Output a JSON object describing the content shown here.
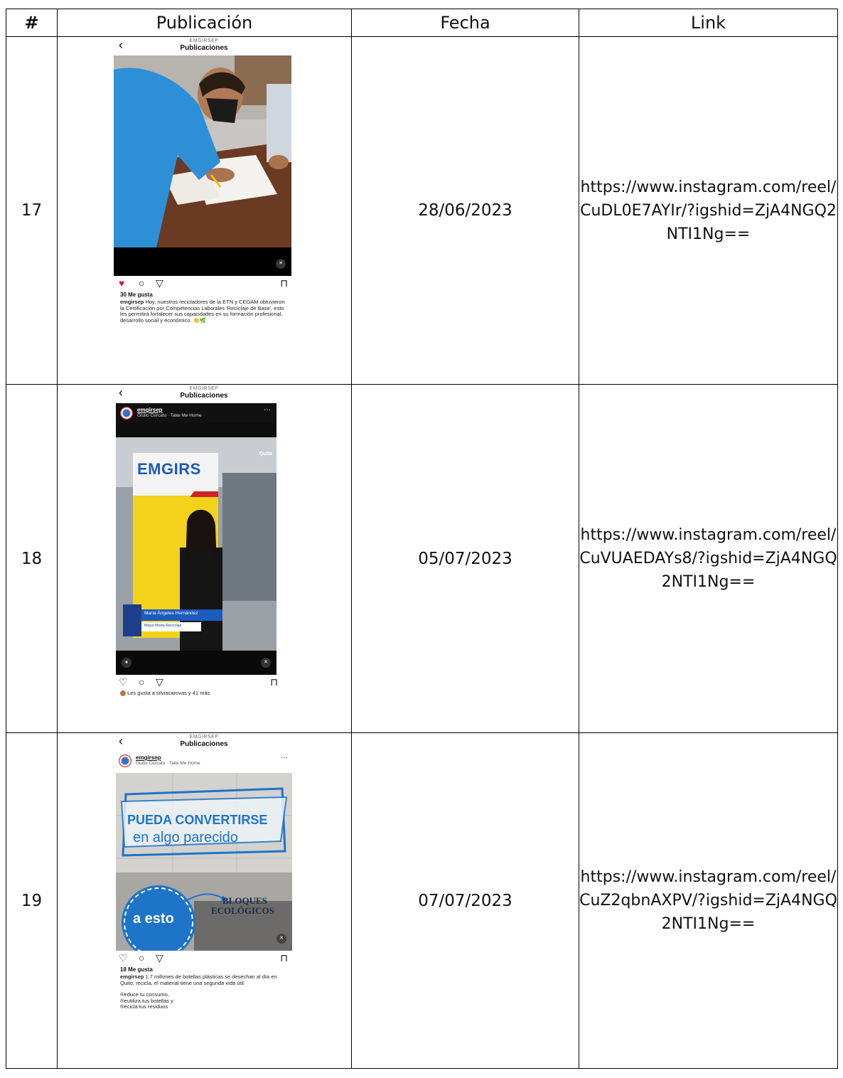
{
  "table": {
    "headers": {
      "num": "#",
      "publication": "Publicación",
      "date": "Fecha",
      "link": "Link"
    },
    "rows": [
      {
        "num": "17",
        "date": "28/06/2023",
        "link": "https://www.instagram.com/reel/CuDL0E7AYIr/?igshid=ZjA4NGQ2NTI1Ng==",
        "post": {
          "account": "EMGIRSEP",
          "title": "Publicaciones",
          "likes": "30 Me gusta",
          "caption_user": "emgirsep",
          "caption": " Hoy, nuestros recicladores de la ETN y CEGAM obtuvieron la Certificación por Competencias Laborales 'Reciclaje de Base', esto les permitirá fortalecer sus capacidades en su formación profesional, desarrollo social y económico. 👏🌿"
        }
      },
      {
        "num": "18",
        "date": "05/07/2023",
        "link": "https://www.instagram.com/reel/CuVUAEDAYs8/?igshid=ZjA4NGQ2NTI1Ng==",
        "post": {
          "account": "EMGIRSEP",
          "title": "Publicaciones",
          "user": "emgirsep",
          "music": "Giulio Cercato · Take Me Home",
          "sign": "EMGIRS",
          "brand": "Quito",
          "lower_third_name": "María Ángeles Hernández",
          "lower_third_role": "Maya Moda Reciclaje",
          "liked_by": "Les gusta a silviacarovas y 41 más"
        }
      },
      {
        "num": "19",
        "date": "07/07/2023",
        "link": "https://www.instagram.com/reel/CuZ2qbnAXPV/?igshid=ZjA4NGQ2NTI1Ng==",
        "post": {
          "account": "EMGIRSEP",
          "title": "Publicaciones",
          "user": "emgirsep",
          "music": "Giulio Cercato · Take Me Home",
          "headline1": "PUEDA CONVERTIRSE",
          "headline2": "en algo parecido",
          "circle": "a esto",
          "blocks1": "BLOQUES",
          "blocks2": "ECOLÓGICOS",
          "likes": "18 Me gusta",
          "caption_user": "emgirsep",
          "caption": " 1.7 millones de botellas plásticas se desechan al día en Quito, recicla, el material tiene una segunda vida útil.",
          "line1": "®educe tu consumo,",
          "line2": "®eutiliza tus botellas y",
          "line3": "®ecicla tus residuos"
        }
      }
    ]
  },
  "icons": {
    "back": "chevron-left-icon",
    "heart": "heart-icon",
    "comment": "comment-icon",
    "share": "send-icon",
    "save": "bookmark-icon",
    "mute": "mute-icon"
  },
  "colors": {
    "like_red": "#e0163c",
    "emgirs_blue": "#1d5bbf",
    "sign_yellow": "#f2d21a"
  }
}
